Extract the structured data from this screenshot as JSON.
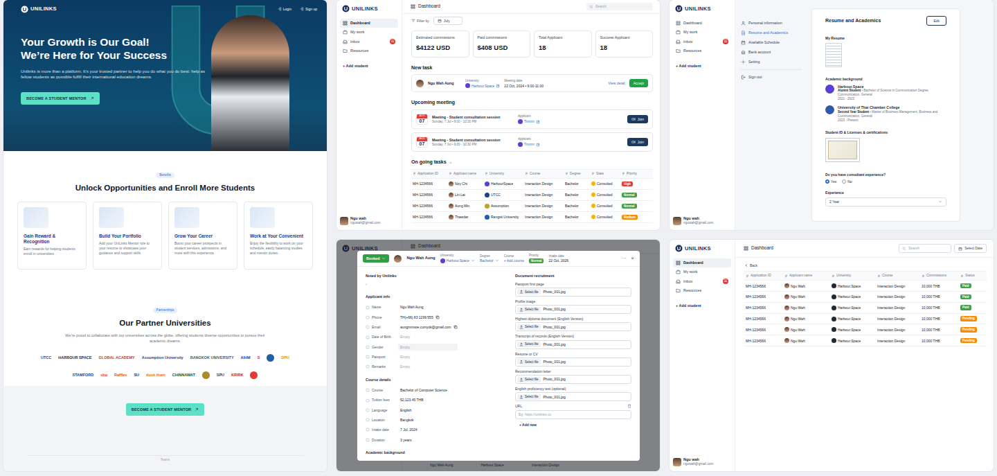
{
  "landing": {
    "logo": "UNILINKS",
    "nav": [
      "Login",
      "Sign up"
    ],
    "hero": {
      "title": [
        "Your Growth is Our Goal!",
        "We’re Here for Your Success"
      ],
      "text": "Unilinks is more than a platform. It’s your trusted partner to help you do what you do best: help as fellow students as possible fulfill their international education dreams.",
      "button": "BECOME A STUDENT MENTOR"
    },
    "benefits": {
      "tag": "Benefits",
      "title": "Unlock Opportunities and Enroll More Students",
      "cards": [
        {
          "title": "Gain Reward & Recognition",
          "text": "Earn rewards for helping students enroll in universities"
        },
        {
          "title": "Build Your Portfolio",
          "text": "Add your UniLinks Mentor role to your resume to showcase your guidance and support skills"
        },
        {
          "title": "Grow Your Career",
          "text": "Boost your career prospects in student services, admissions, and more with this experience."
        },
        {
          "title": "Work at Your Convenient",
          "text": "Enjoy the flexibility to work on your schedule, easily balancing studies and mentor duties."
        }
      ]
    },
    "partners": {
      "tag": "Partnerships",
      "title": "Our Partner Universities",
      "text": "We’re proud to collaborate with top universities across the globe, offering students diverse opportunities to pursue their academic dreams.",
      "logos": [
        [
          {
            "kind": "text",
            "name": "UTCC",
            "color": "#1d3f8a"
          },
          {
            "kind": "text",
            "name": "HARBOUR SPACE",
            "color": "#1a1f5c"
          },
          {
            "kind": "text",
            "name": "GLOBAL ACADEMY",
            "color": "#c0392b"
          },
          {
            "kind": "text",
            "name": "Assumption University",
            "color": "#1f3f8f"
          },
          {
            "kind": "text",
            "name": "BANGKOK UNIVERSITY",
            "color": "#4b5563"
          },
          {
            "kind": "text",
            "name": "AIHM",
            "color": "#1e3a8a"
          },
          {
            "kind": "text",
            "name": "S",
            "color": "#d32f2f"
          },
          {
            "kind": "mark",
            "name": "",
            "color": "#1e5fa8"
          },
          {
            "kind": "text",
            "name": "DPU",
            "color": "#e08a1e"
          }
        ],
        [
          {
            "kind": "text",
            "name": "STAMFORD",
            "color": "#1e3a8a"
          },
          {
            "kind": "text",
            "name": "sbu",
            "color": "#e53935"
          },
          {
            "kind": "text",
            "name": "Raffles",
            "color": "#e65100"
          },
          {
            "kind": "text",
            "name": "SU",
            "color": "#1f2937"
          },
          {
            "kind": "text",
            "name": "dusit thani",
            "color": "#ef6c00"
          },
          {
            "kind": "text",
            "name": "CHINNAWAT",
            "color": "#14532d"
          },
          {
            "kind": "mark",
            "name": "",
            "color": "#b08a2a"
          },
          {
            "kind": "text",
            "name": "SPU",
            "color": "#1e3a8a"
          },
          {
            "kind": "text",
            "name": "KRIRK",
            "color": "#b91c1c"
          },
          {
            "kind": "mark",
            "name": "",
            "color": "#e53935"
          }
        ]
      ],
      "button": "BECOME A STUDENT MENTOR"
    },
    "footer": "Teams"
  },
  "dashboard": {
    "sidebar": {
      "logo": "UNILINKS",
      "items": [
        {
          "label": "Dashboard",
          "selected": true
        },
        {
          "label": "My work",
          "selected": false
        },
        {
          "label": "Inbox",
          "selected": false,
          "badge": "11"
        },
        {
          "label": "Resources",
          "selected": false
        }
      ],
      "add": "+ Add student",
      "user": {
        "name": "Ngu wah",
        "email": "nguwah@gmail.com"
      }
    },
    "title": "Dashboard",
    "search": "Search",
    "filter": {
      "label": "Filter by",
      "value": "July"
    },
    "stats": [
      {
        "label": "Estimated commissions",
        "value": "$4122 USD"
      },
      {
        "label": "Paid commissions",
        "value": "$408 USD"
      },
      {
        "label": "Total Applicant",
        "value": "18"
      },
      {
        "label": "Success Applicant",
        "value": "18"
      }
    ],
    "new_task": {
      "title": "New task",
      "name": "Ngu Wah Aung",
      "university_label": "University",
      "university": "Harbour.Space",
      "date_label": "Meeting date",
      "date": "22 Oct, 2024 • 9:00-11:00",
      "detail": "View detail",
      "accept": "Accept"
    },
    "meetings": {
      "title": "Upcoming meeting",
      "items": [
        {
          "month": "AUG",
          "day": "07",
          "title": "Meeting - Student consultation session",
          "time": "Sunday, 7 Jul • 9:00 - 10:30 PM",
          "applicant_label": "Applicant",
          "applicant": "Tinnnn",
          "join": "Join"
        },
        {
          "month": "AUG",
          "day": "07",
          "title": "Meeting - Student consultation session",
          "time": "Sunday, 7 Jul • 9:00 - 10:30 PM",
          "applicant_label": "Applicant",
          "applicant": "Tinnnn",
          "join": "Join"
        }
      ]
    },
    "tasks": {
      "title": "On going tasks",
      "expanded": true,
      "columns": [
        "Application ID",
        "Applicant name",
        "University",
        "Course",
        "Degree",
        "State",
        "Priority"
      ],
      "rows": [
        {
          "id": "MH-1234566",
          "name": "Noy Chi",
          "university": "HarbourSpace",
          "uni_color": "#5b3fd1",
          "course": "Interaction Design",
          "degree": "Bachelor",
          "state": "Consulted",
          "priority": "High",
          "color": "#e53935"
        },
        {
          "id": "MH-1234566",
          "name": "Lin Lat",
          "university": "UTCC",
          "uni_color": "#1d3f8a",
          "course": "Interaction Design",
          "degree": "Bachelor",
          "state": "Consulted",
          "priority": "Normal",
          "color": "#43a047"
        },
        {
          "id": "MH-1234566",
          "name": "Aung Min",
          "university": "Assumption",
          "uni_color": "#c4a02b",
          "course": "Interaction Design",
          "degree": "Bachelor",
          "state": "Consulted",
          "priority": "Normal",
          "color": "#43a047"
        },
        {
          "id": "MH-1234566",
          "name": "Thawdar",
          "university": "Rangsit University",
          "uni_color": "#1e5fa8",
          "course": "Interaction Design",
          "degree": "Bachelor",
          "state": "Consulted",
          "priority": "Medium",
          "color": "#fb8c00"
        }
      ]
    }
  },
  "resume": {
    "sidebar": {
      "logo": "UNILINKS",
      "items": [
        {
          "label": "Dashboard",
          "selected": false
        },
        {
          "label": "My work",
          "selected": false
        },
        {
          "label": "Inbox",
          "selected": false,
          "badge": "11"
        },
        {
          "label": "Resources",
          "selected": false
        }
      ],
      "add": "+ Add student",
      "user": {
        "name": "Ngu wah",
        "email": "nguwah@gmail.com"
      }
    },
    "menu": [
      {
        "label": "Personal information",
        "selected": false
      },
      {
        "label": "Resume and Academics",
        "selected": true
      },
      {
        "label": "Available Schedule",
        "selected": false
      },
      {
        "label": "Bank account",
        "selected": false
      },
      {
        "label": "Setting",
        "selected": false
      }
    ],
    "sign_out": "Sign out",
    "title": "Resume and Academics",
    "edit": "Edit",
    "my_resume": "My Resume",
    "academic": {
      "title": "Academic background",
      "items": [
        {
          "school": "Harbour.Space",
          "status": "Alumni Student",
          "detail": "• Bachelor of Science in Communication Degree, Communication, General",
          "years": "2021 - 2023",
          "color": "#5b3fd1"
        },
        {
          "school": "University of Thai Chamber College",
          "status": "Second Year Student",
          "detail": "• Master of Business Management, Business and Communication, General",
          "years": "2023 - Present",
          "color": "#2f5aa8"
        }
      ]
    },
    "licenses": "Student ID & Licenses & certifications",
    "question": "Do you have consultant experience?",
    "options": [
      {
        "label": "Yes",
        "selected": true
      },
      {
        "label": "No",
        "selected": false
      }
    ],
    "experience": {
      "label": "Experience",
      "value": "2 Year"
    }
  },
  "modal": {
    "backdrop": {
      "logo": "UNILINKS",
      "title": "Dashboard",
      "row": [
        "Ngu Wah Aung",
        "Harbour.Space",
        "Interaction Design"
      ]
    },
    "status": "Booked",
    "name": "Ngu Wah Aung",
    "university": {
      "label": "University",
      "value": "Harbour.Space",
      "color": "#5b3fd1"
    },
    "degree": {
      "label": "Degree",
      "value": "Bachelor"
    },
    "course": {
      "label": "Course",
      "value": "+ Add course"
    },
    "priority": {
      "label": "Priority",
      "value": "Normal",
      "color": "#43a047"
    },
    "intake": {
      "label": "Intake date",
      "value": "22 Oct, 2026"
    },
    "more": "···",
    "close": "×",
    "note": {
      "title": "Noted by Unilinks",
      "value": "-"
    },
    "applicant": {
      "title": "Applicant info",
      "rows": [
        {
          "label": "Name",
          "value": "Ngu Wah Aung",
          "empty": false,
          "copy": false,
          "hovered": false
        },
        {
          "label": "Phone",
          "value": "TH(+66) 83 1299 555",
          "empty": false,
          "copy": true,
          "hovered": false
        },
        {
          "label": "Email",
          "value": "aungminsoe.cumyok@gmail.com",
          "empty": false,
          "copy": true,
          "hovered": false
        },
        {
          "label": "Date of Birth",
          "value": "Empty",
          "empty": true,
          "copy": false,
          "hovered": false
        },
        {
          "label": "Gender",
          "value": "Empty",
          "empty": true,
          "copy": false,
          "hovered": true
        },
        {
          "label": "Passport",
          "value": "Empty",
          "empty": true,
          "copy": false,
          "hovered": false
        },
        {
          "label": "Remarks",
          "value": "Empty",
          "empty": true,
          "copy": false,
          "hovered": false
        }
      ]
    },
    "course_details": {
      "title": "Course details",
      "rows": [
        {
          "label": "Course",
          "value": "Bachelor of Computer Science"
        },
        {
          "label": "Tuition fees",
          "value": "52,123.45 THB"
        },
        {
          "label": "Language",
          "value": "English"
        },
        {
          "label": "Location",
          "value": "Bangkok"
        },
        {
          "label": "Intake date",
          "value": "7 Jul, 2024"
        },
        {
          "label": "Duration",
          "value": "3 years"
        }
      ]
    },
    "academic_title": "Academic background",
    "documents": {
      "title": "Document recruitment",
      "items": [
        {
          "label": "Passport first page",
          "button": "Select file",
          "file": "Photo_001.jpg"
        },
        {
          "label": "Profile image",
          "button": "Select file",
          "file": "Photo_001.jpg"
        },
        {
          "label": "Highest diploma document (English Version)",
          "button": "Select file",
          "file": "Photo_001.jpg"
        },
        {
          "label": "Transcript of records (English Version)",
          "button": "Select file",
          "file": "Photo_001.jpg"
        },
        {
          "label": "Resume or CV",
          "button": "Select file",
          "file": "Photo_001.jpg"
        },
        {
          "label": "Recommendation letter",
          "button": "Select file",
          "file": "Photo_001.jpg"
        },
        {
          "label": "English proficiency test (optional)",
          "button": "Select file",
          "file": "Photo_001.jpg"
        }
      ],
      "url": {
        "label": "URL",
        "placeholder": "Eg: https://unilinks.co"
      },
      "add": "+ Add new"
    }
  },
  "commissions": {
    "sidebar": {
      "logo": "UNILINKS",
      "items": [
        {
          "label": "Dashboard",
          "selected": true
        },
        {
          "label": "My work",
          "selected": false
        },
        {
          "label": "Inbox",
          "selected": false,
          "badge": "11"
        },
        {
          "label": "Resources",
          "selected": false
        }
      ],
      "add": "+ Add student",
      "user": {
        "name": "Ngu wah",
        "email": "nguwah@gmail.com"
      }
    },
    "title": "Dashboard",
    "search": "Search",
    "date": "Select Date",
    "back": "Back",
    "columns": [
      "Application ID",
      "Applicant name",
      "University",
      "Course",
      "Commissions",
      "Status"
    ],
    "rows": [
      {
        "id": "MH-1234566",
        "name": "Ngu Wah",
        "university": "Harbour.Space",
        "course": "Interaction Design",
        "amount": "10,000 THB",
        "status": "Paid",
        "color": "#43a047"
      },
      {
        "id": "MH-1234566",
        "name": "Ngu Wah",
        "university": "Harbour.Space",
        "course": "Interaction Design",
        "amount": "10,000 THB",
        "status": "Paid",
        "color": "#43a047"
      },
      {
        "id": "MH-1234566",
        "name": "Ngu Wah",
        "university": "Harbour.Space",
        "course": "Interaction Design",
        "amount": "10,000 THB",
        "status": "Paid",
        "color": "#43a047"
      },
      {
        "id": "MH-1234566",
        "name": "Ngu Wah",
        "university": "Harbour.Space",
        "course": "Interaction Design",
        "amount": "10,000 THB",
        "status": "Pending",
        "color": "#fb8c00"
      },
      {
        "id": "MH-1234566",
        "name": "Ngu Wah",
        "university": "Harbour.Space",
        "course": "Interaction Design",
        "amount": "10,000 THB",
        "status": "Pending",
        "color": "#fb8c00"
      },
      {
        "id": "MH-1234566",
        "name": "Ngu Wah",
        "university": "Harbour.Space",
        "course": "Interaction Design",
        "amount": "10,000 THB",
        "status": "Pending",
        "color": "#fb8c00"
      }
    ]
  }
}
